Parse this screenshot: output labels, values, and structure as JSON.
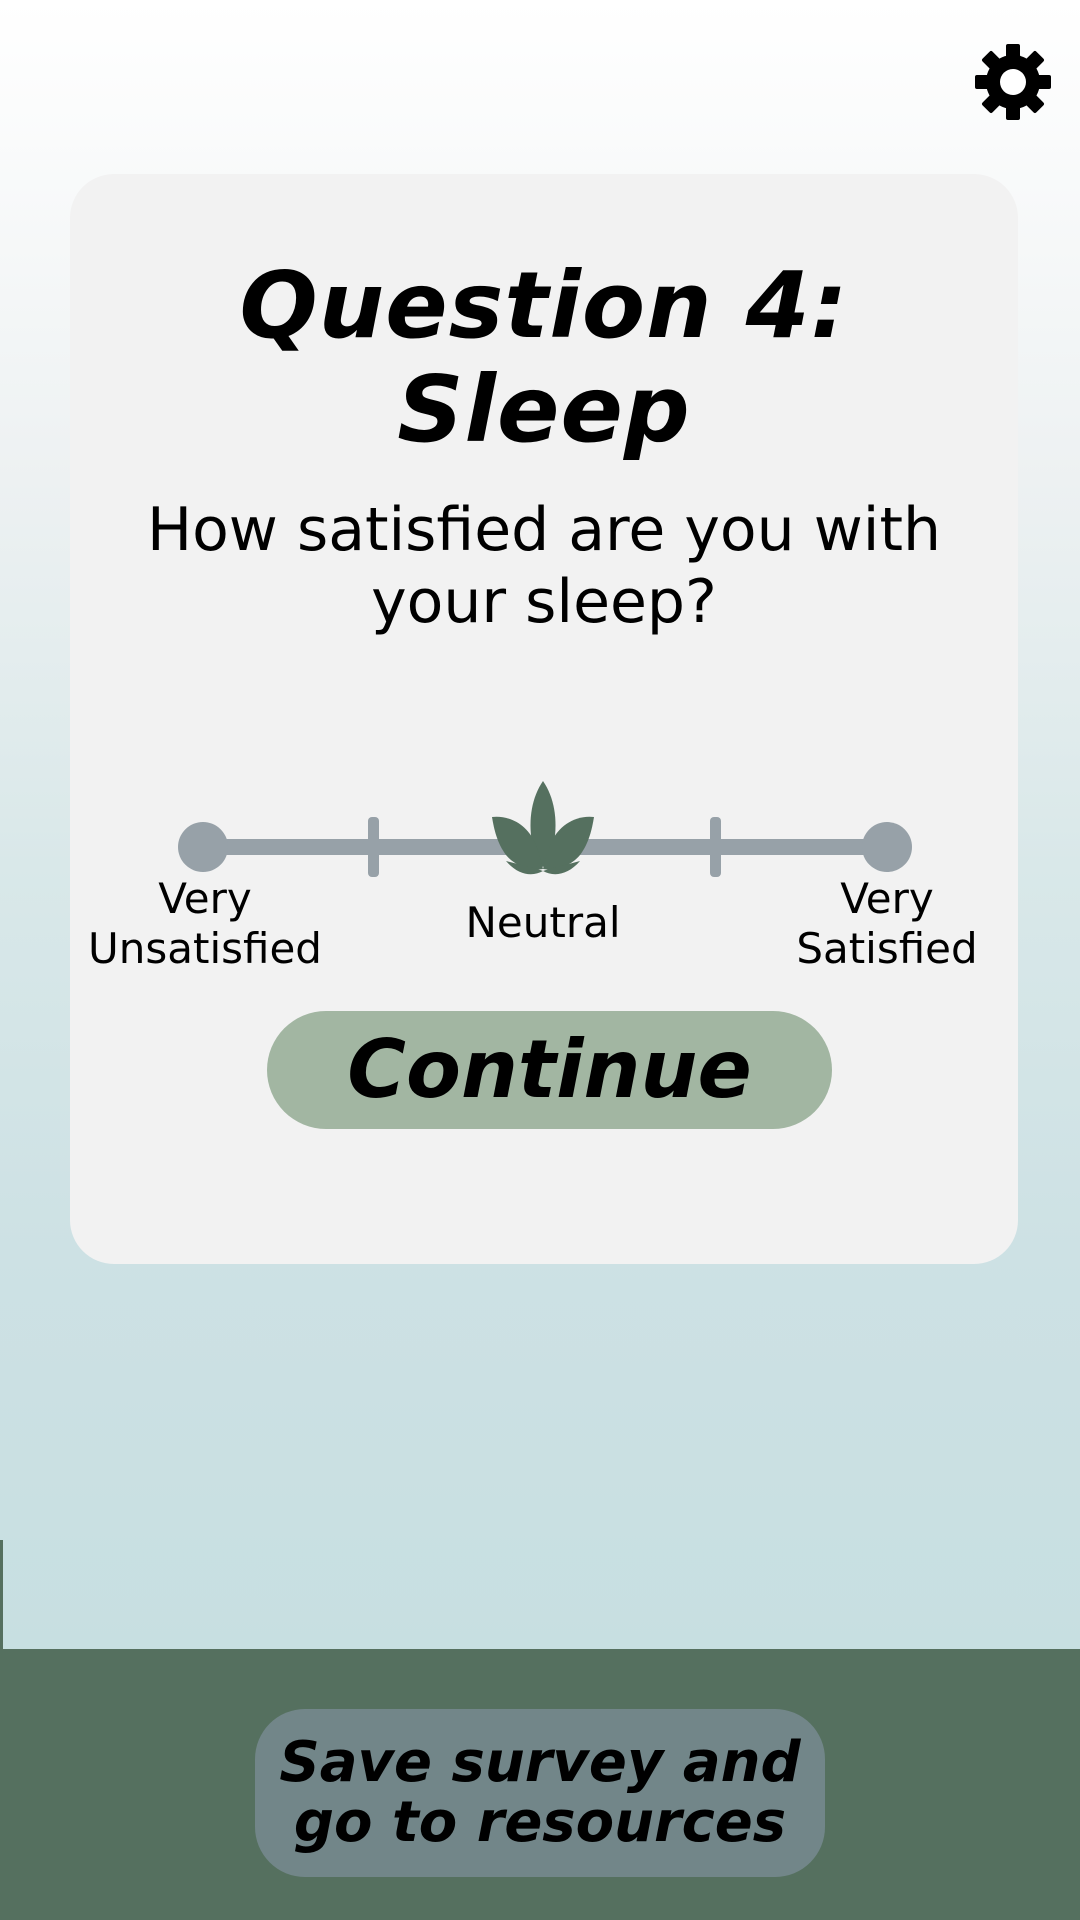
{
  "header": {
    "settings_icon": "gear-icon"
  },
  "question_card": {
    "title_line1": "Question 4:",
    "title_line2": "Sleep",
    "prompt": "How satisfied are you with your sleep?",
    "scale": {
      "selected_value": "Neutral",
      "selected_position": 0.5,
      "selector_icon": "leaf-icon",
      "left_label_line1": "Very",
      "left_label_line2": "Unsatisfied",
      "center_label": "Neutral",
      "right_label_line1": "Very",
      "right_label_line2": "Satisfied"
    },
    "continue_label": "Continue"
  },
  "footer": {
    "save_label_line1": "Save survey and",
    "save_label_line2": "go to resources"
  },
  "colors": {
    "card_background": "#f2f2f2",
    "slider_track": "#97a1a8",
    "leaf": "#55705f",
    "continue_button": "#a2b6a2",
    "footer_background": "#55705f",
    "save_button": "#728689"
  }
}
